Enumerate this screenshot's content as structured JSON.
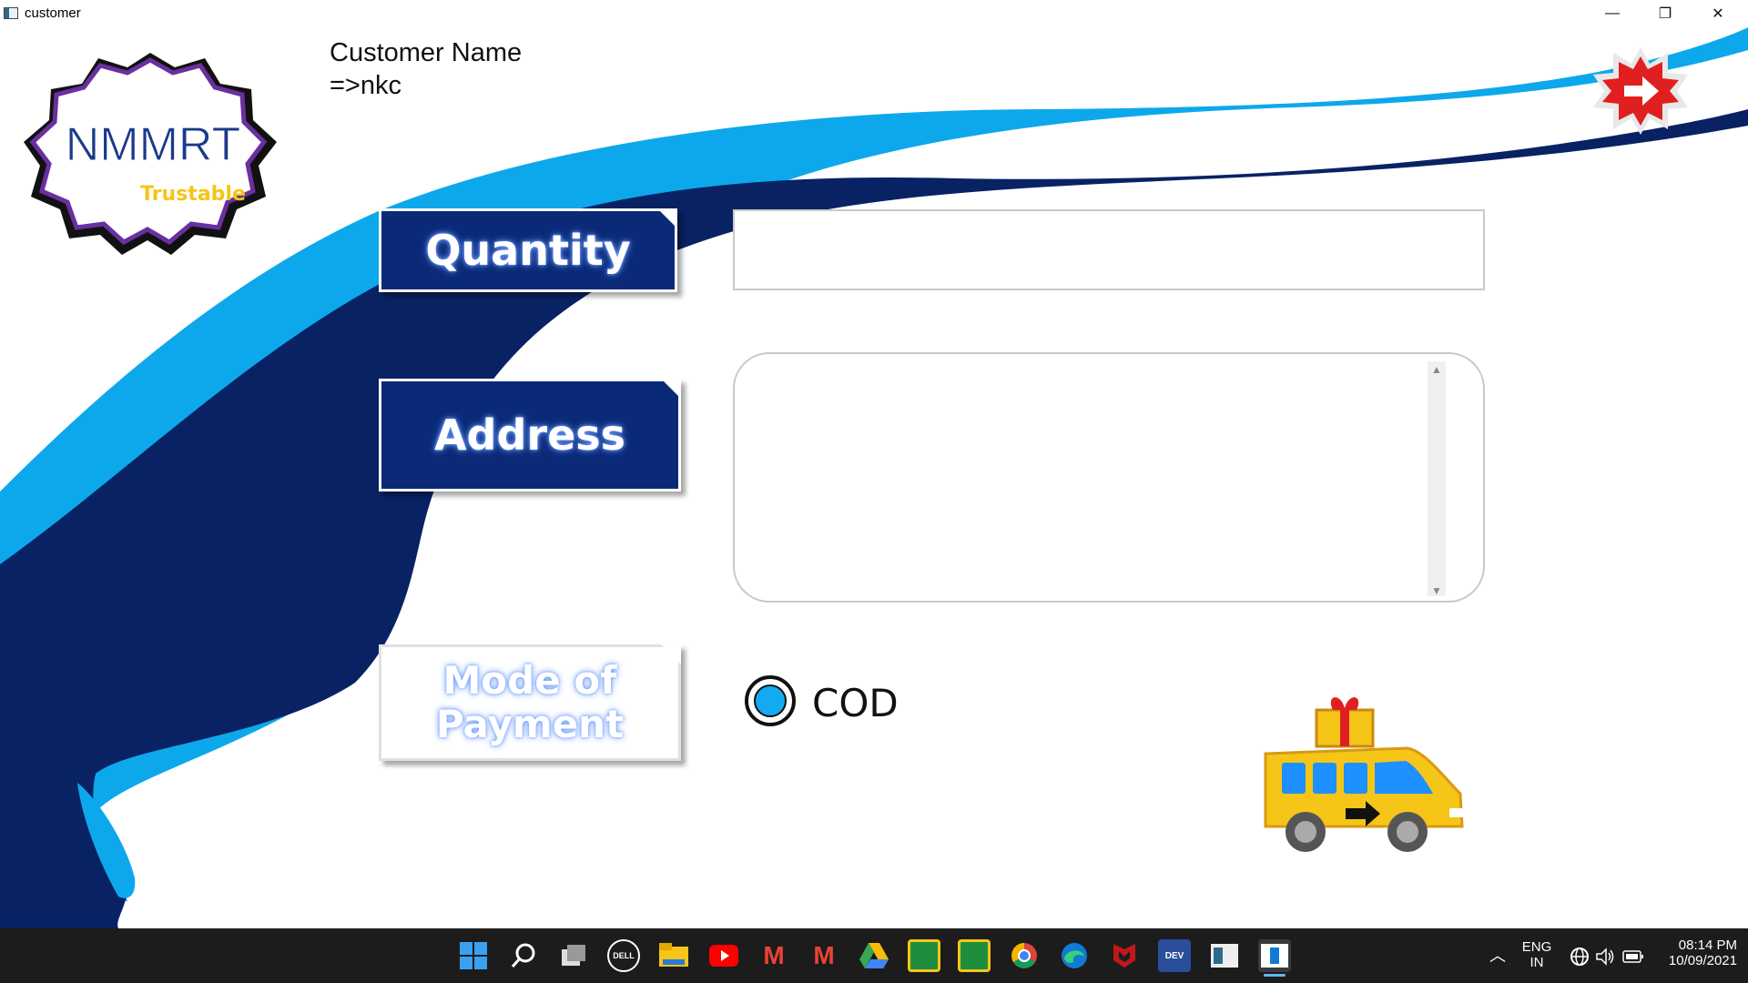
{
  "window": {
    "title": "customer",
    "minimize": "—",
    "restore": "❐",
    "close": "✕"
  },
  "logo": {
    "text": "NMMRT",
    "tagline": "Trustable"
  },
  "customer": {
    "label": "Customer Name",
    "value": "=>nkc"
  },
  "form": {
    "quantity_label": "Quantity",
    "quantity_value": "",
    "address_label": "Address",
    "address_value": "",
    "payment_label_line1": "Mode of",
    "payment_label_line2": "Payment",
    "payment_option": "COD",
    "payment_selected": true
  },
  "icons": {
    "exit": "exit-arrow-icon",
    "delivery": "delivery-van-icon"
  },
  "colors": {
    "dark_blue": "#0a2a78",
    "light_blue": "#14aaf0",
    "accent_red": "#e02020",
    "logo_purple": "#6a2fa0",
    "logo_yellow": "#f5c518"
  },
  "taskbar": {
    "apps": [
      "start",
      "search",
      "task-view",
      "dell",
      "file-explorer",
      "youtube",
      "gmail",
      "gmail-2",
      "google-drive",
      "google-classroom",
      "google-classroom-2",
      "chrome",
      "edge",
      "mcafee",
      "dev-cpp",
      "app-window",
      "customer-app"
    ],
    "lang_line1": "ENG",
    "lang_line2": "IN",
    "time": "08:14 PM",
    "date": "10/09/2021"
  }
}
